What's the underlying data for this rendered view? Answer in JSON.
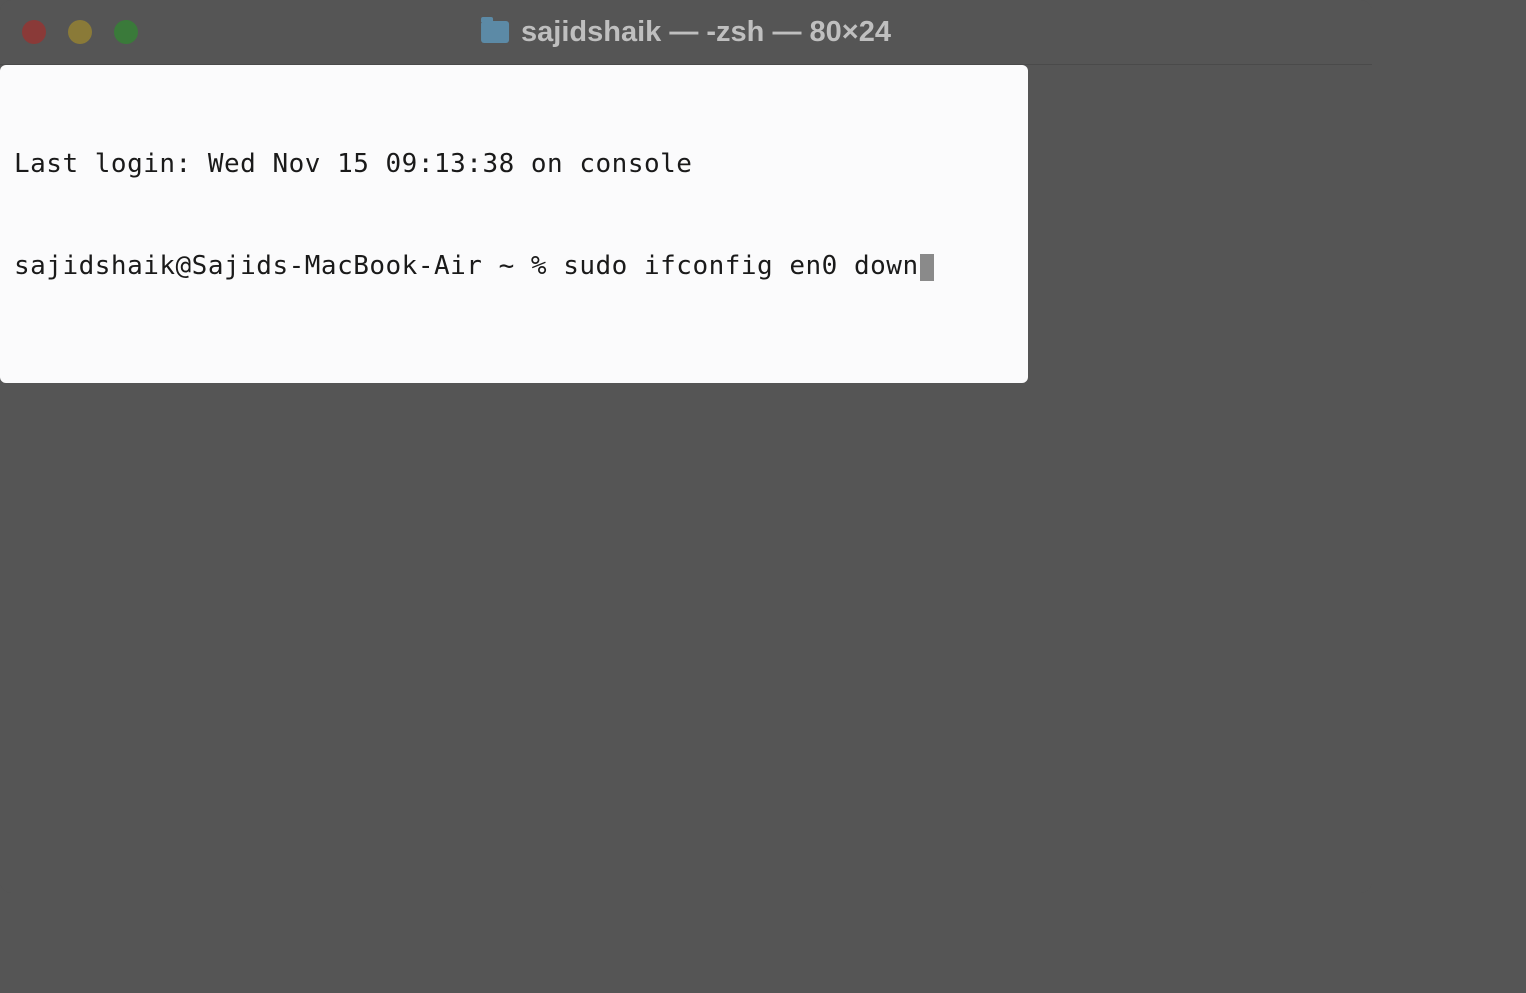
{
  "titlebar": {
    "title": "sajidshaik — -zsh — 80×24"
  },
  "terminal": {
    "login_line": "Last login: Wed Nov 15 09:13:38 on console",
    "prompt": "sajidshaik@Sajids-MacBook-Air ~ % ",
    "command": "sudo ifconfig en0 down"
  }
}
